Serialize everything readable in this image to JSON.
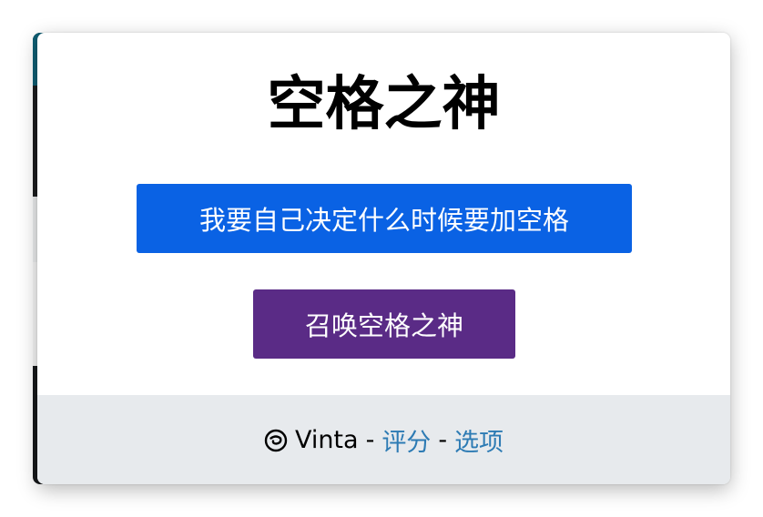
{
  "popup": {
    "title": "空格之神",
    "primary_button_label": "我要自己决定什么时候要加空格",
    "secondary_button_label": "召唤空格之神"
  },
  "footer": {
    "logo_icon": "vinta-swirl-icon",
    "author": "Vinta",
    "separator": "-",
    "rate_link": "评分",
    "options_link": "选项"
  },
  "colors": {
    "primary_button": "#0a62e4",
    "secondary_button": "#5a2b86",
    "footer_background": "#e7eaed",
    "link": "#2d7bb4"
  }
}
